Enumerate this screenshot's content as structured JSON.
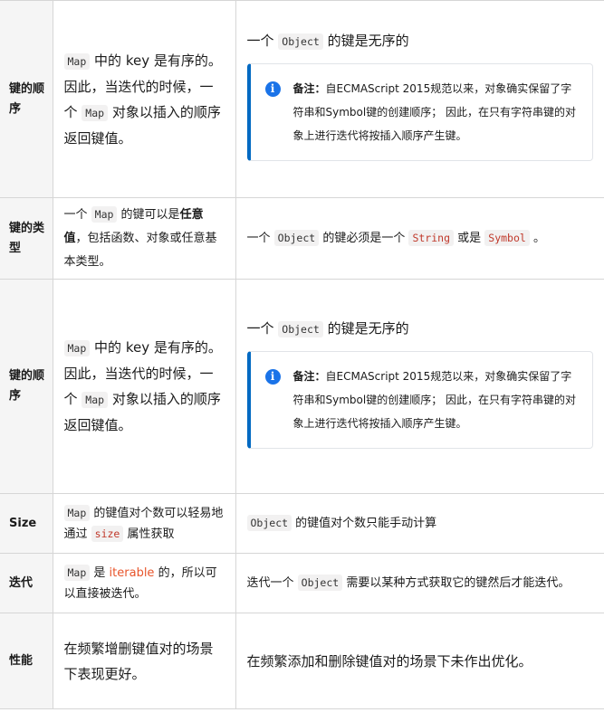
{
  "rows": [
    {
      "head": "键的顺序",
      "mid": {
        "code1": "Map",
        "t1": " 中的 key 是有序的。因此，当迭代的时候，一个 ",
        "code2": "Map",
        "t2": " 对象以插入的顺序返回键值。"
      },
      "right": {
        "t1": "一个 ",
        "code": "Object",
        "t2": " 的键是无序的",
        "note_label": "备注：",
        "note_text": "自ECMAScript 2015规范以来，对象确实保留了字符串和Symbol键的创建顺序； 因此，在只有字符串键的对象上进行迭代将按插入顺序产生键。"
      }
    },
    {
      "head": "键的类型",
      "mid": {
        "t1": "一个 ",
        "code1": "Map",
        "t2": " 的键可以是",
        "strong": "任意值",
        "t3": "，包括函数、对象或任意基本类型。"
      },
      "right": {
        "t1": "一个 ",
        "code1": "Object",
        "t2": " 的键必须是一个 ",
        "code2": "String",
        "t3": " 或是 ",
        "code3": "Symbol",
        "t4": " 。"
      }
    },
    {
      "head": "键的顺序",
      "mid": {
        "code1": "Map",
        "t1": " 中的 key 是有序的。因此，当迭代的时候，一个 ",
        "code2": "Map",
        "t2": " 对象以插入的顺序返回键值。"
      },
      "right": {
        "t1": "一个 ",
        "code": "Object",
        "t2": " 的键是无序的",
        "note_label": "备注：",
        "note_text": "自ECMAScript 2015规范以来，对象确实保留了字符串和Symbol键的创建顺序； 因此，在只有字符串键的对象上进行迭代将按插入顺序产生键。"
      }
    },
    {
      "head": "Size",
      "mid": {
        "code1": "Map",
        "t1": " 的键值对个数可以轻易地通过 ",
        "code2": "size",
        "t2": " 属性获取"
      },
      "right": {
        "code": "Object",
        "t1": " 的键值对个数只能手动计算"
      }
    },
    {
      "head": "迭代",
      "mid": {
        "code1": "Map",
        "t1": " 是 ",
        "kw": "iterable",
        "t2": " 的，所以可以直接被迭代。"
      },
      "right": {
        "t1": "迭代一个 ",
        "code": "Object",
        "t2": " 需要以某种方式获取它的键然后才能迭代。"
      }
    },
    {
      "head": "性能",
      "mid": {
        "t1": "在频繁增删键值对的场景下表现更好。"
      },
      "right": {
        "t1": "在频繁添加和删除键值对的场景下未作出优化。"
      }
    }
  ],
  "icons": {
    "note": "info-icon"
  }
}
